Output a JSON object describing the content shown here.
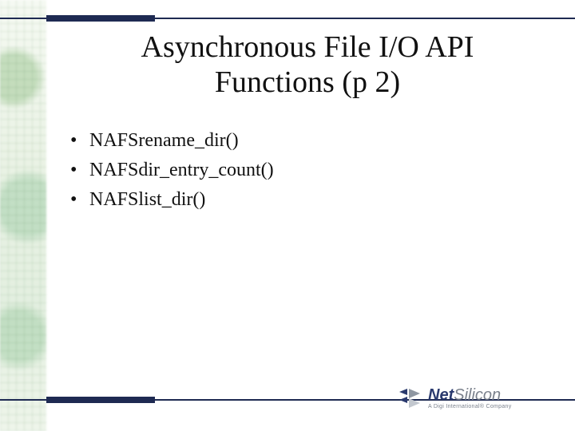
{
  "title_line1": "Asynchronous File I/O API",
  "title_line2": "Functions (p 2)",
  "bullets": {
    "items": [
      "NAFSrename_dir()",
      "NAFSdir_entry_count()",
      "NAFSlist_dir()"
    ]
  },
  "logo": {
    "brand_net": "Net",
    "brand_silicon": "Silicon",
    "tagline": "A Digi International® Company"
  },
  "colors": {
    "accent_navy": "#1e2a52",
    "logo_blue": "#2a3a6e",
    "logo_gray": "#7a818c"
  }
}
